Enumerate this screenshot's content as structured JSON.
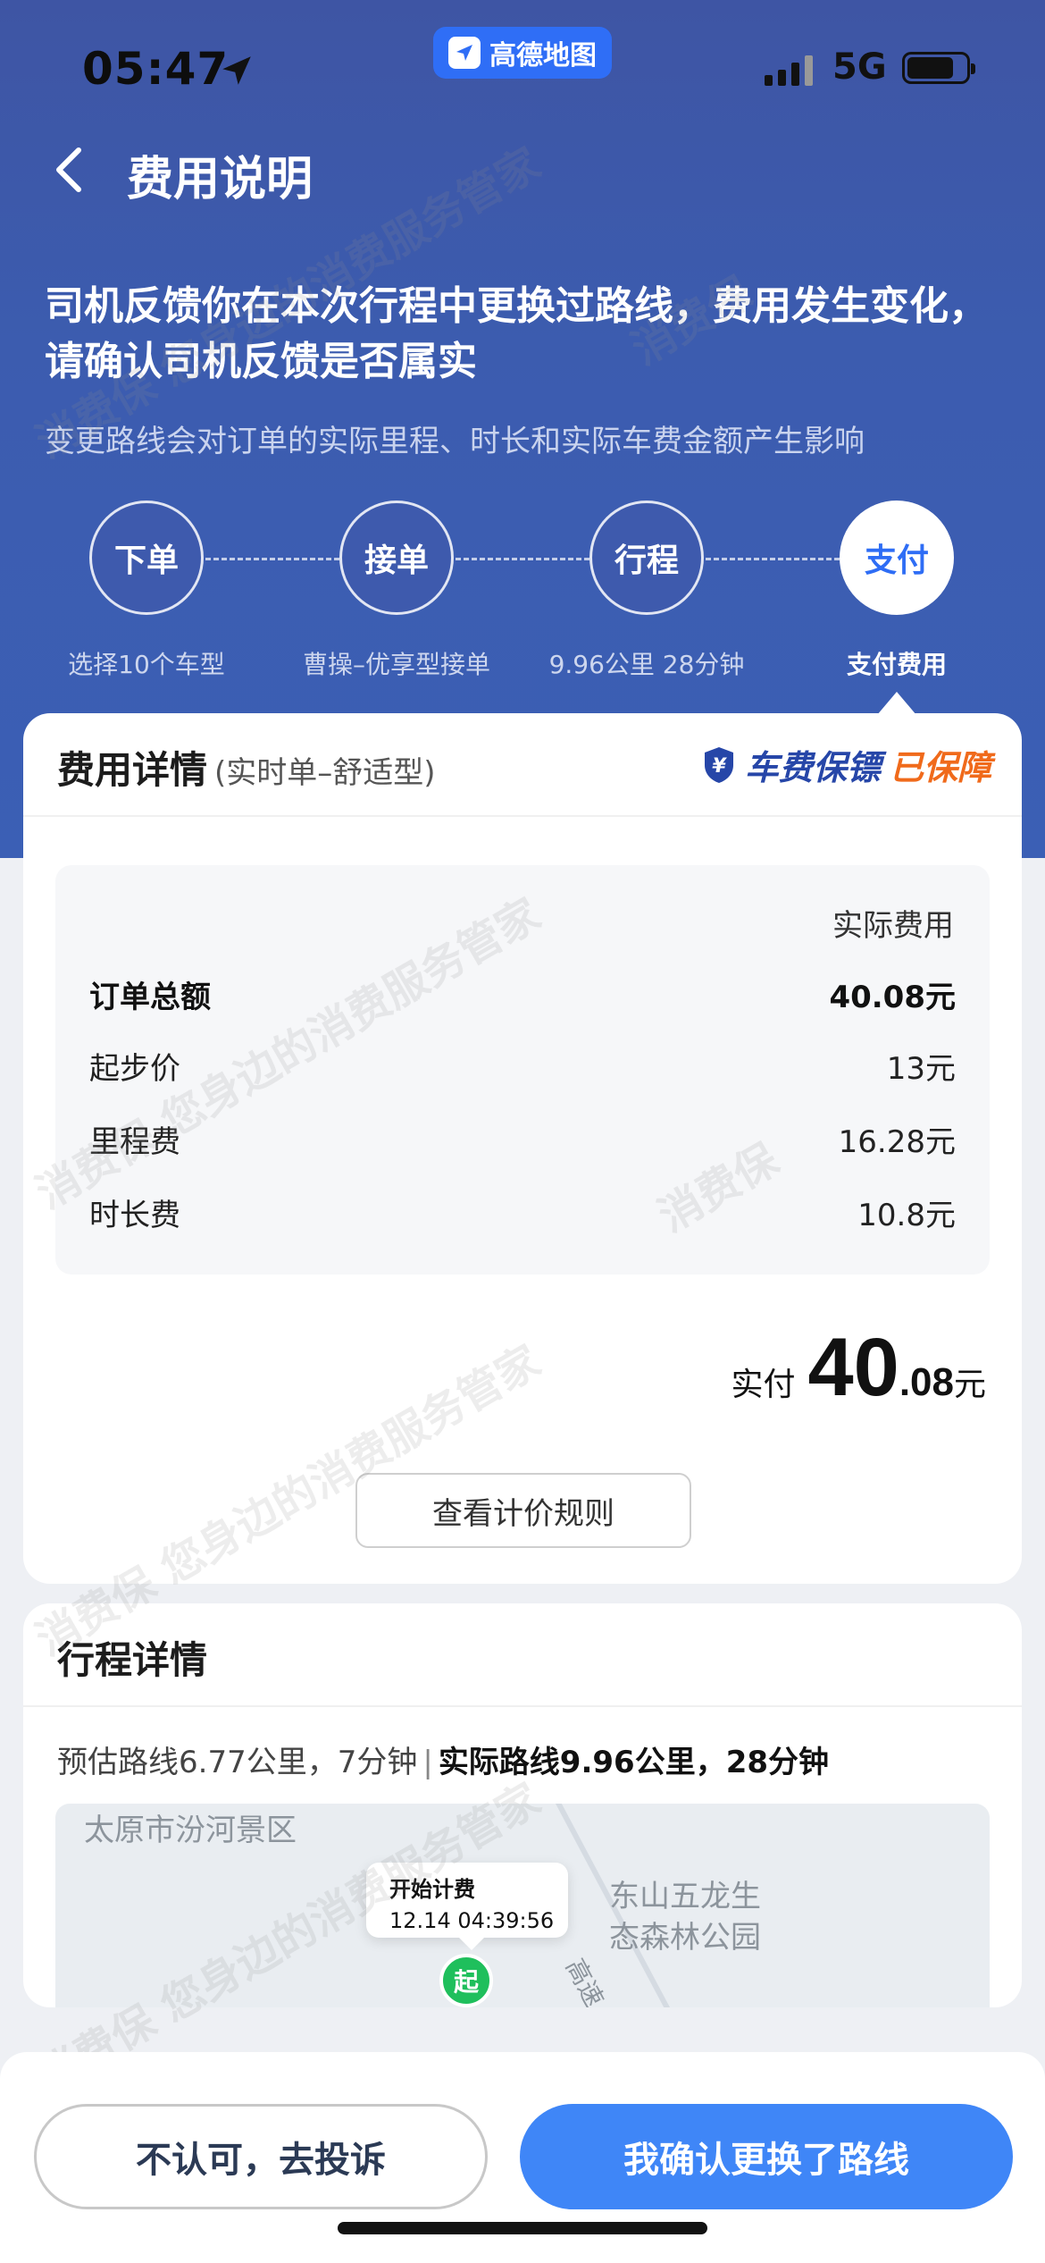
{
  "status_bar": {
    "time": "05:47",
    "app_name": "高德地图",
    "network": "5G"
  },
  "nav": {
    "title": "费用说明"
  },
  "notice": {
    "headline": "司机反馈你在本次行程中更换过路线，费用发生变化，请确认司机反馈是否属实",
    "subline": "变更路线会对订单的实际里程、时长和实际车费金额产生影响"
  },
  "steps": [
    {
      "label": "下单",
      "caption": "选择10个车型",
      "active": false
    },
    {
      "label": "接单",
      "caption": "曹操–优享型接单",
      "active": false
    },
    {
      "label": "行程",
      "caption": "9.96公里 28分钟",
      "active": false
    },
    {
      "label": "支付",
      "caption": "支付费用",
      "active": true
    }
  ],
  "fee_card": {
    "title": "费用详情",
    "subtitle": "(实时单–舒适型)",
    "badge_part1": "车费保镖",
    "badge_part2": "已保障",
    "column_header": "实际费用",
    "rows": [
      {
        "label": "订单总额",
        "value": "40.08元",
        "bold": true
      },
      {
        "label": "起步价",
        "value": "13元"
      },
      {
        "label": "里程费",
        "value": "16.28元"
      },
      {
        "label": "时长费",
        "value": "10.8元"
      }
    ],
    "paid_label": "实付",
    "paid_int": "40",
    "paid_dec": ".08",
    "paid_unit": "元",
    "rules_button": "查看计价规则"
  },
  "trip_card": {
    "title": "行程详情",
    "estimated": "预估路线6.77公里，7分钟",
    "separator": "|",
    "actual": "实际路线9.96公里，28分钟",
    "map": {
      "label_top": "太原市汾河景区",
      "label_park_line1": "东山五龙生",
      "label_park_line2": "态森林公园",
      "label_road": "高速",
      "bubble_title": "开始计费",
      "bubble_time": "12.14 04:39:56",
      "start_pin": "起"
    }
  },
  "actions": {
    "complain": "不认可，去投诉",
    "confirm": "我确认更换了路线"
  },
  "watermark": {
    "text_a": "消费保 您身边的消费服务管家",
    "text_b": "消费保"
  },
  "colors": {
    "primary": "#3f86f7",
    "header_bg": "#3c5caf",
    "badge_blue": "#2646a8",
    "badge_orange": "#f06a1b",
    "pin_green": "#1fbf5c"
  }
}
